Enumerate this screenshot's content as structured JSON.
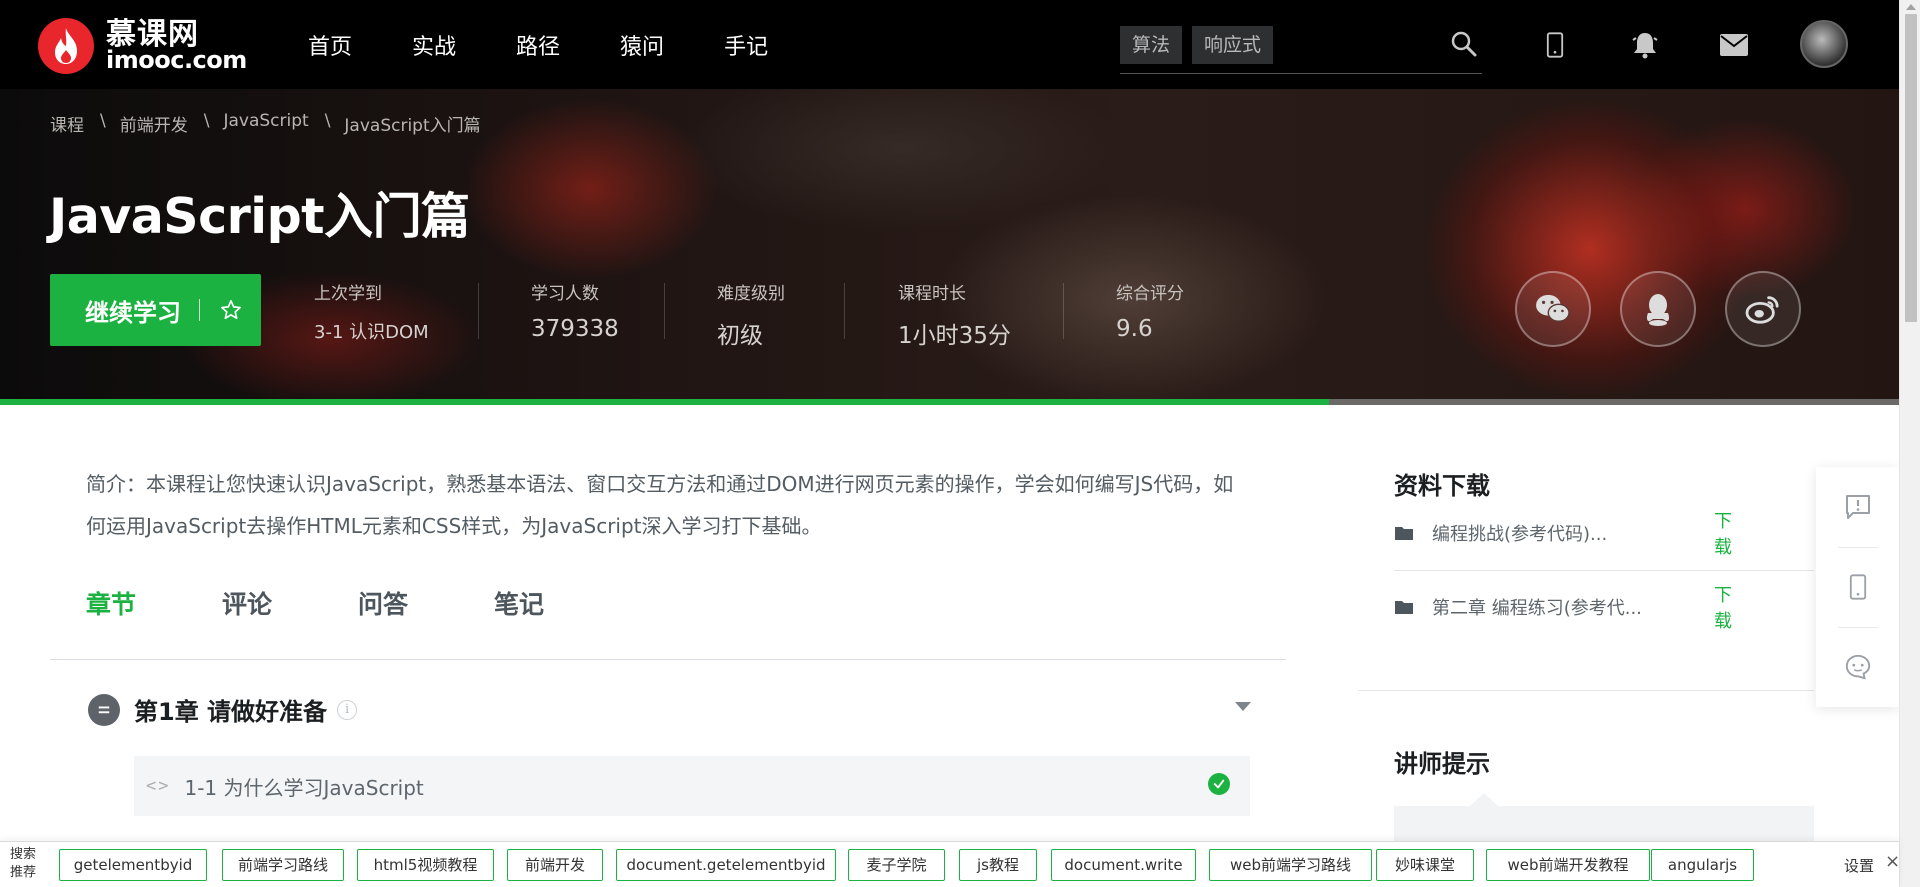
{
  "header": {
    "logo_cn": "慕课网",
    "logo_en": "imooc.com",
    "nav": [
      "首页",
      "实战",
      "路径",
      "猿问",
      "手记"
    ],
    "search_tags": [
      "算法",
      "响应式"
    ]
  },
  "hero": {
    "breadcrumb": [
      "课程",
      "前端开发",
      "JavaScript",
      "JavaScript入门篇"
    ],
    "title": "JavaScript入门篇",
    "continue_label": "继续学习",
    "stats": [
      {
        "label": "上次学到",
        "value": "3-1 认识DOM"
      },
      {
        "label": "学习人数",
        "value": "379338"
      },
      {
        "label": "难度级别",
        "value": "初级"
      },
      {
        "label": "课程时长",
        "value": "1小时35分"
      },
      {
        "label": "综合评分",
        "value": "9.6"
      }
    ],
    "progress": 0.7
  },
  "course": {
    "intro": "简介：本课程让您快速认识JavaScript，熟悉基本语法、窗口交互方法和通过DOM进行网页元素的操作，学会如何编写JS代码，如何运用JavaScript去操作HTML元素和CSS样式，为JavaScript深入学习打下基础。",
    "tabs": [
      "章节",
      "评论",
      "问答",
      "笔记"
    ],
    "chapter_title": "第1章 请做好准备",
    "lesson_title": "1-1 为什么学习JavaScript"
  },
  "sidebar": {
    "resources_title": "资料下载",
    "resources": [
      {
        "name": "编程挑战(参考代码)...",
        "action": "下载"
      },
      {
        "name": "第二章 编程练习(参考代...",
        "action": "下载"
      }
    ],
    "tips_title": "讲师提示"
  },
  "bottom_bar": {
    "label": "搜索推荐",
    "tags": [
      "getelementbyid",
      "前端学习路线",
      "html5视频教程",
      "前端开发",
      "document.getelementbyid",
      "麦子学院",
      "js教程",
      "document.write",
      "web前端学习路线",
      "妙味课堂",
      "web前端开发教程",
      "angularjs"
    ],
    "settings": "设置",
    "close": "×"
  },
  "colors": {
    "accent": "#1cb241",
    "nav_bg": "#000000",
    "logo_red": "#e8262c"
  },
  "icons": [
    "search-icon",
    "mobile-icon",
    "bell-icon",
    "mail-icon",
    "star-icon",
    "wechat-icon",
    "qq-icon",
    "weibo-icon",
    "folder-icon",
    "check-icon",
    "feedback-icon",
    "chat-icon"
  ]
}
